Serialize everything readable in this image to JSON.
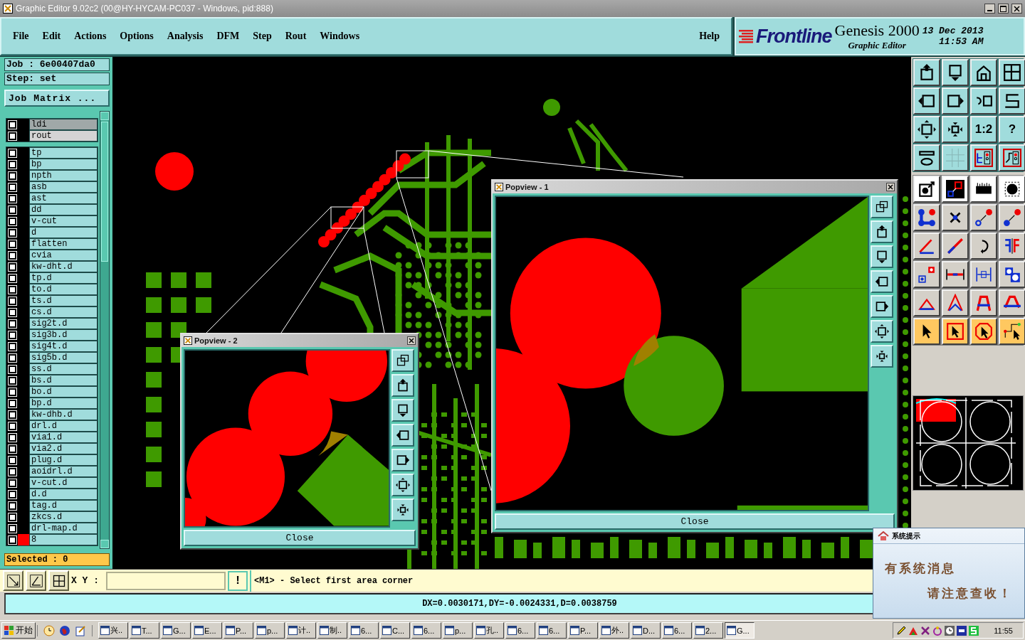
{
  "window": {
    "title": "Graphic Editor 9.02c2 (00@HY-HYCAM-PC037 - Windows, pid:888)"
  },
  "menu": [
    "File",
    "Edit",
    "Actions",
    "Options",
    "Analysis",
    "DFM",
    "Step",
    "Rout",
    "Windows"
  ],
  "help": "Help",
  "brand": {
    "logo": "Frontline",
    "product": "Genesis 2000",
    "subtitle": "Graphic Editor",
    "date": "13 Dec 2013",
    "time": "11:53 AM"
  },
  "job": {
    "job": "Job : 6e00407da0",
    "step": "Step: set",
    "matrix_button": "Job Matrix ...",
    "selected": "Selected : 0"
  },
  "layer_groups": [
    {
      "kind": "board",
      "items": [
        {
          "name": "ldi",
          "checked": false,
          "color": "#000000",
          "selected": true
        },
        {
          "name": "rout",
          "checked": false,
          "color": "#000000",
          "selected": false
        }
      ]
    },
    {
      "kind": "misc",
      "items": [
        {
          "name": "tp",
          "checked": false,
          "color": "#000000",
          "selected": false
        },
        {
          "name": "bp",
          "checked": false,
          "color": "#000000",
          "selected": false
        },
        {
          "name": "npth",
          "checked": false,
          "color": "#000000",
          "selected": false
        },
        {
          "name": "asb",
          "checked": false,
          "color": "#000000",
          "selected": false
        },
        {
          "name": "ast",
          "checked": false,
          "color": "#000000",
          "selected": false
        },
        {
          "name": "dd",
          "checked": false,
          "color": "#000000",
          "selected": false
        },
        {
          "name": "v-cut",
          "checked": false,
          "color": "#000000",
          "selected": false
        },
        {
          "name": "d",
          "checked": false,
          "color": "#000000",
          "selected": false
        },
        {
          "name": "flatten",
          "checked": false,
          "color": "#000000",
          "selected": false
        },
        {
          "name": "cvia",
          "checked": false,
          "color": "#000000",
          "selected": false
        },
        {
          "name": "kw-dht.d",
          "checked": false,
          "color": "#000000",
          "selected": false
        },
        {
          "name": "tp.d",
          "checked": false,
          "color": "#000000",
          "selected": false
        },
        {
          "name": "to.d",
          "checked": false,
          "color": "#000000",
          "selected": false
        },
        {
          "name": "ts.d",
          "checked": false,
          "color": "#000000",
          "selected": false
        },
        {
          "name": "cs.d",
          "checked": false,
          "color": "#000000",
          "selected": false
        },
        {
          "name": "sig2t.d",
          "checked": false,
          "color": "#000000",
          "selected": false
        },
        {
          "name": "sig3b.d",
          "checked": false,
          "color": "#000000",
          "selected": false
        },
        {
          "name": "sig4t.d",
          "checked": false,
          "color": "#000000",
          "selected": false
        },
        {
          "name": "sig5b.d",
          "checked": false,
          "color": "#000000",
          "selected": false
        },
        {
          "name": "ss.d",
          "checked": false,
          "color": "#000000",
          "selected": false
        },
        {
          "name": "bs.d",
          "checked": false,
          "color": "#000000",
          "selected": false
        },
        {
          "name": "bo.d",
          "checked": false,
          "color": "#000000",
          "selected": false
        },
        {
          "name": "bp.d",
          "checked": false,
          "color": "#000000",
          "selected": false
        },
        {
          "name": "kw-dhb.d",
          "checked": false,
          "color": "#000000",
          "selected": false
        },
        {
          "name": "drl.d",
          "checked": false,
          "color": "#000000",
          "selected": false
        },
        {
          "name": "via1.d",
          "checked": false,
          "color": "#000000",
          "selected": false
        },
        {
          "name": "via2.d",
          "checked": false,
          "color": "#000000",
          "selected": false
        },
        {
          "name": "plug.d",
          "checked": false,
          "color": "#000000",
          "selected": false
        },
        {
          "name": "aoidrl.d",
          "checked": false,
          "color": "#000000",
          "selected": false
        },
        {
          "name": "v-cut.d",
          "checked": false,
          "color": "#000000",
          "selected": false
        },
        {
          "name": "d.d",
          "checked": false,
          "color": "#000000",
          "selected": false
        },
        {
          "name": "tag.d",
          "checked": false,
          "color": "#000000",
          "selected": false
        },
        {
          "name": "zkcs.d",
          "checked": false,
          "color": "#000000",
          "selected": false
        },
        {
          "name": "drl-map.d",
          "checked": false,
          "color": "#000000",
          "selected": false
        },
        {
          "name": "8",
          "checked": false,
          "color": "#ff0000",
          "selected": false
        }
      ]
    }
  ],
  "toolbar": {
    "zoom_label": "1:2",
    "help_label": "?"
  },
  "popviews": [
    {
      "title": "Popview - 1",
      "close": "Close"
    },
    {
      "title": "Popview - 2",
      "close": "Close"
    }
  ],
  "command": {
    "xy_label": "X Y :",
    "confirm": "!",
    "prompt": "<M1> - Select first area corner"
  },
  "status": "DX=0.0030171,DY=-0.0024331,D=0.0038759",
  "notification": {
    "title": "系统提示",
    "lines": [
      "有系统消息",
      "请注意查收！"
    ]
  },
  "taskbar": {
    "start": "开始",
    "tasks": [
      {
        "label": "兴..",
        "selected": false
      },
      {
        "label": "T...",
        "selected": false
      },
      {
        "label": "G...",
        "selected": false
      },
      {
        "label": "E...",
        "selected": false
      },
      {
        "label": "P...",
        "selected": false
      },
      {
        "label": "p...",
        "selected": false
      },
      {
        "label": "计..",
        "selected": false
      },
      {
        "label": "制..",
        "selected": false
      },
      {
        "label": "6...",
        "selected": false
      },
      {
        "label": "C...",
        "selected": false
      },
      {
        "label": "6...",
        "selected": false
      },
      {
        "label": "p...",
        "selected": false
      },
      {
        "label": "孔..",
        "selected": false
      },
      {
        "label": "6...",
        "selected": false
      },
      {
        "label": "6...",
        "selected": false
      },
      {
        "label": "P...",
        "selected": false
      },
      {
        "label": "外..",
        "selected": false
      },
      {
        "label": "D...",
        "selected": false
      },
      {
        "label": "6...",
        "selected": false
      },
      {
        "label": "2...",
        "selected": false
      },
      {
        "label": "G...",
        "selected": true
      }
    ],
    "clock": "11:55"
  }
}
